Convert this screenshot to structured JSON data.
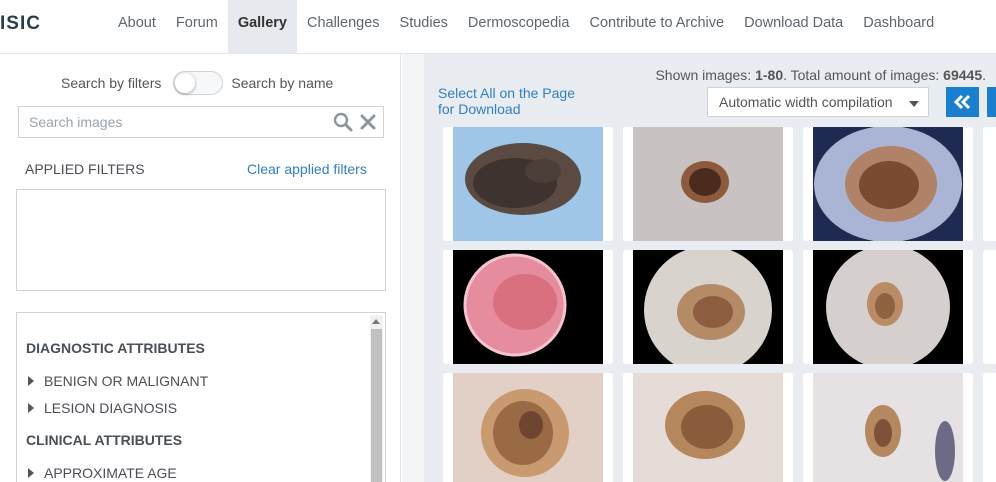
{
  "app": {
    "logo": "ISIC"
  },
  "nav": {
    "items": [
      {
        "label": "About"
      },
      {
        "label": "Forum"
      },
      {
        "label": "Gallery",
        "active": true
      },
      {
        "label": "Challenges"
      },
      {
        "label": "Studies"
      },
      {
        "label": "Dermoscopedia"
      },
      {
        "label": "Contribute to Archive"
      },
      {
        "label": "Download Data"
      },
      {
        "label": "Dashboard"
      }
    ]
  },
  "sidebar": {
    "search_by_filters": "Search by filters",
    "search_by_name": "Search by name",
    "search_placeholder": "Search images",
    "applied_filters_label": "APPLIED FILTERS",
    "clear_applied_filters": "Clear applied filters",
    "diagnostic_attributes": "DIAGNOSTIC ATTRIBUTES",
    "benign_or_malignant": "BENIGN OR MALIGNANT",
    "lesion_diagnosis": "LESION DIAGNOSIS",
    "clinical_attributes": "CLINICAL ATTRIBUTES",
    "approximate_age": "APPROXIMATE AGE"
  },
  "gallery": {
    "select_all": "Select All on the Page for Download",
    "shown_prefix": "Shown images: ",
    "shown_range": "1-80",
    "total_prefix": ". Total amount of images: ",
    "total_count": "69445",
    "total_suffix": ".",
    "width_mode": "Automatic width compilation"
  },
  "colors": {
    "accent": "#1a7fcf",
    "link": "#2f7fc4",
    "panel_bg": "#e9edf1"
  }
}
